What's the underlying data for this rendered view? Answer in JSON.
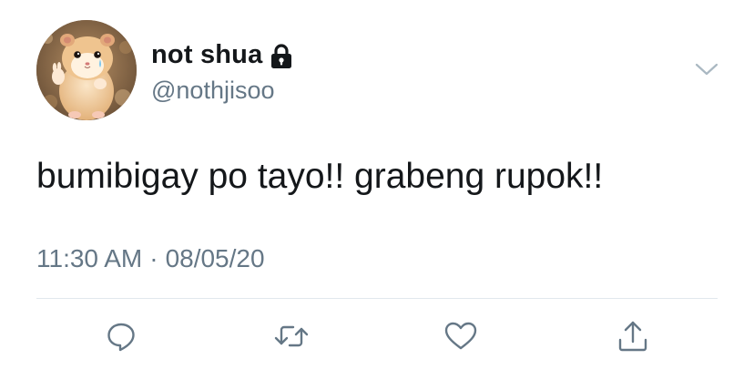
{
  "tweet": {
    "display_name": "not shua",
    "handle": "@nothjisoo",
    "protected": true,
    "text": "bumibigay po tayo!! grabeng rupok!!",
    "time": "11:30 AM",
    "separator": "·",
    "date": "08/05/20"
  },
  "icons": {
    "lock": "lock-icon",
    "caret": "chevron-down-icon",
    "reply": "reply-icon",
    "retweet": "retweet-icon",
    "like": "heart-icon",
    "share": "share-icon"
  },
  "colors": {
    "primary_text": "#14171a",
    "secondary_text": "#657786",
    "divider": "#e1e8ed"
  }
}
